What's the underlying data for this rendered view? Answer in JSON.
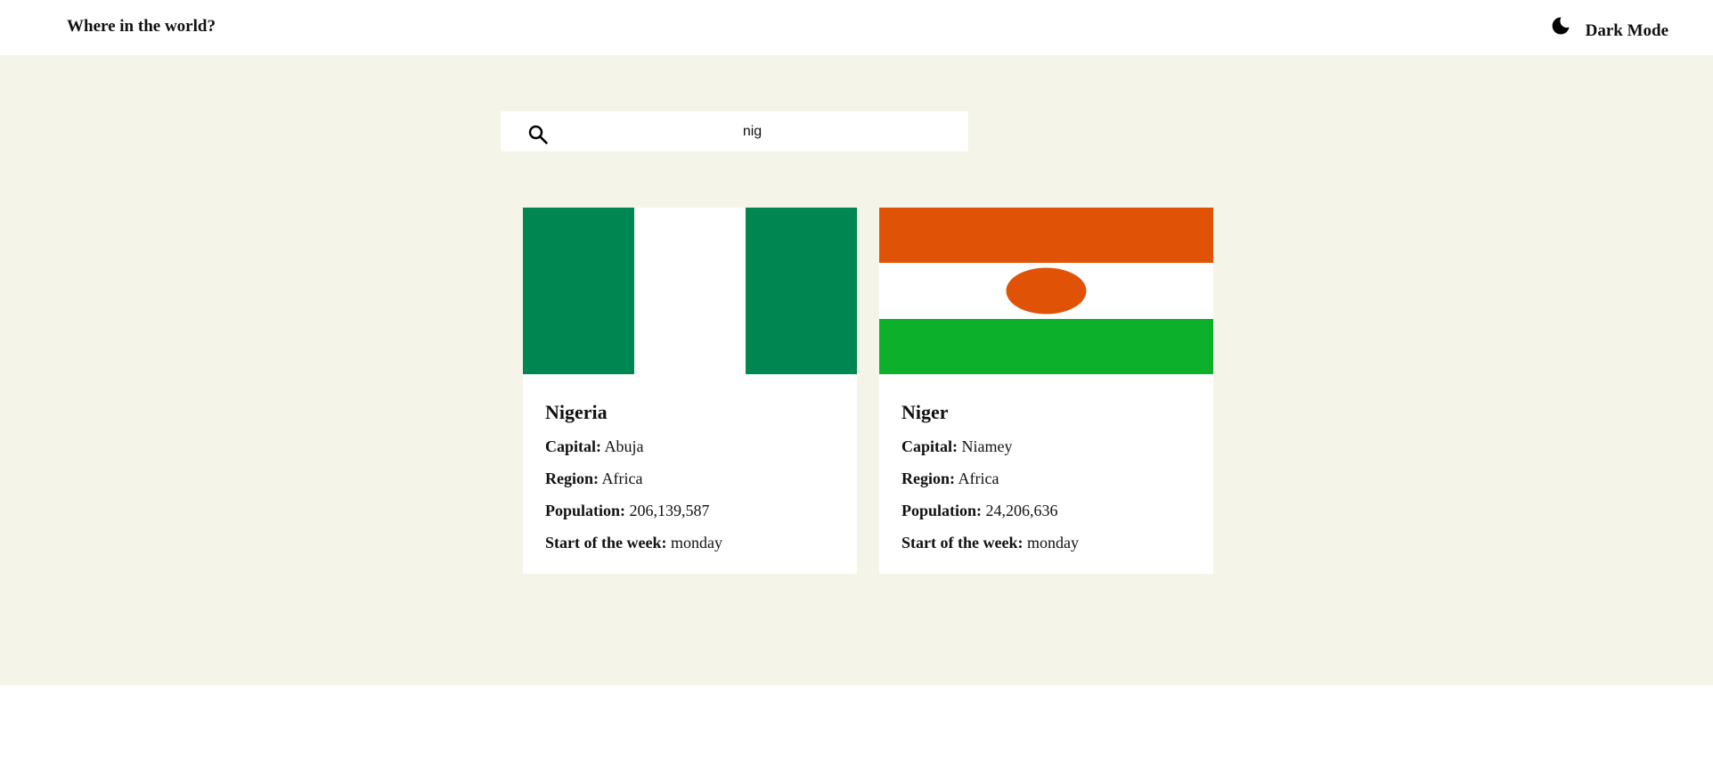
{
  "header": {
    "title": "Where in the world?",
    "theme_toggle_label": "Dark Mode",
    "theme_icon": "moon-icon"
  },
  "search": {
    "icon": "search-icon",
    "value": "nig"
  },
  "countries": [
    {
      "name": "Nigeria",
      "flag": {
        "colors": [
          "#008751",
          "#ffffff",
          "#008751"
        ],
        "layout": "vertical-tricolor"
      },
      "capital_label": "Capital:",
      "capital": "Abuja",
      "region_label": "Region:",
      "region": "Africa",
      "population_label": "Population:",
      "population": "206,139,587",
      "week_label": "Start of the week:",
      "week_start": "monday"
    },
    {
      "name": "Niger",
      "flag": {
        "colors": [
          "#e05206",
          "#ffffff",
          "#0db02b"
        ],
        "layout": "horizontal-tricolor-with-disc",
        "disc_color": "#e05206"
      },
      "capital_label": "Capital:",
      "capital": "Niamey",
      "region_label": "Region:",
      "region": "Africa",
      "population_label": "Population:",
      "population": "24,206,636",
      "week_label": "Start of the week:",
      "week_start": "monday"
    }
  ],
  "colors": {
    "page_background": "#f4f4e9",
    "card_background": "#ffffff",
    "text": "#111111"
  }
}
